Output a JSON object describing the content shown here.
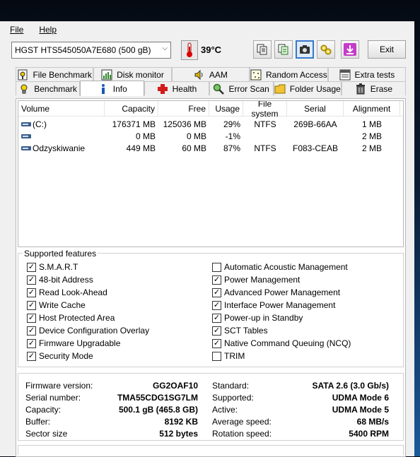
{
  "menu": {
    "file": "File",
    "help": "Help"
  },
  "toolbar": {
    "drive": "HGST HTS545050A7E680 (500 gB)",
    "temperature": "39°C",
    "exit_label": "Exit",
    "buttons": [
      "copy-text-icon",
      "copy-to-clipboard-icon",
      "camera-icon",
      "settings-icon",
      "download-arrow-icon"
    ]
  },
  "tabs_top": [
    {
      "label": "File Benchmark",
      "icon": "file-benchmark-icon"
    },
    {
      "label": "Disk monitor",
      "icon": "disk-monitor-icon"
    },
    {
      "label": "AAM",
      "icon": "speaker-icon"
    },
    {
      "label": "Random Access",
      "icon": "random-access-icon"
    },
    {
      "label": "Extra tests",
      "icon": "extra-tests-icon"
    }
  ],
  "tabs_bottom": [
    {
      "label": "Benchmark",
      "icon": "benchmark-icon"
    },
    {
      "label": "Info",
      "icon": "info-icon",
      "selected": true
    },
    {
      "label": "Health",
      "icon": "health-cross-icon"
    },
    {
      "label": "Error Scan",
      "icon": "magnifier-icon"
    },
    {
      "label": "Folder Usage",
      "icon": "folder-icon"
    },
    {
      "label": "Erase",
      "icon": "trash-icon"
    }
  ],
  "volumes": {
    "headers": [
      "Volume",
      "Capacity",
      "Free",
      "Usage",
      "File system",
      "Serial",
      "Alignment"
    ],
    "rows": [
      {
        "volume": "(C:)",
        "capacity": "176371 MB",
        "free": "125036 MB",
        "usage": "29%",
        "fs": "NTFS",
        "serial": "269B-66AA",
        "alignment": "1 MB"
      },
      {
        "volume": "",
        "capacity": "0 MB",
        "free": "0 MB",
        "usage": "-1%",
        "fs": "",
        "serial": "",
        "alignment": "2 MB"
      },
      {
        "volume": "Odzyskiwanie",
        "capacity": "449 MB",
        "free": "60 MB",
        "usage": "87%",
        "fs": "NTFS",
        "serial": "F083-CEAB",
        "alignment": "2 MB"
      }
    ]
  },
  "features": {
    "title": "Supported features",
    "left": [
      {
        "label": "S.M.A.R.T",
        "checked": true
      },
      {
        "label": "48-bit Address",
        "checked": true
      },
      {
        "label": "Read Look-Ahead",
        "checked": true
      },
      {
        "label": "Write Cache",
        "checked": true
      },
      {
        "label": "Host Protected Area",
        "checked": true
      },
      {
        "label": "Device Configuration Overlay",
        "checked": true
      },
      {
        "label": "Firmware Upgradable",
        "checked": true
      },
      {
        "label": "Security Mode",
        "checked": true
      }
    ],
    "right": [
      {
        "label": "Automatic Acoustic Management",
        "checked": false
      },
      {
        "label": "Power Management",
        "checked": true
      },
      {
        "label": "Advanced Power Management",
        "checked": true
      },
      {
        "label": "Interface Power Management",
        "checked": true
      },
      {
        "label": "Power-up in Standby",
        "checked": true
      },
      {
        "label": "SCT Tables",
        "checked": true
      },
      {
        "label": "Native Command Queuing (NCQ)",
        "checked": true
      },
      {
        "label": "TRIM",
        "checked": false
      }
    ]
  },
  "info": {
    "left": [
      {
        "label": "Firmware version:",
        "value": "GG2OAF10"
      },
      {
        "label": "Serial number:",
        "value": "TMA55CDG1SG7LM"
      },
      {
        "label": "Capacity:",
        "value": "500.1 gB (465.8 GB)"
      },
      {
        "label": "Buffer:",
        "value": "8192 KB"
      },
      {
        "label": "Sector size",
        "value": "512 bytes"
      }
    ],
    "right": [
      {
        "label": "Standard:",
        "value": "SATA 2.6 (3.0 Gb/s)"
      },
      {
        "label": "Supported:",
        "value": "UDMA Mode 6"
      },
      {
        "label": "Active:",
        "value": "UDMA Mode 5"
      },
      {
        "label": "Average speed:",
        "value": "68 MB/s"
      },
      {
        "label": "Rotation speed:",
        "value": "5400 RPM"
      }
    ]
  }
}
